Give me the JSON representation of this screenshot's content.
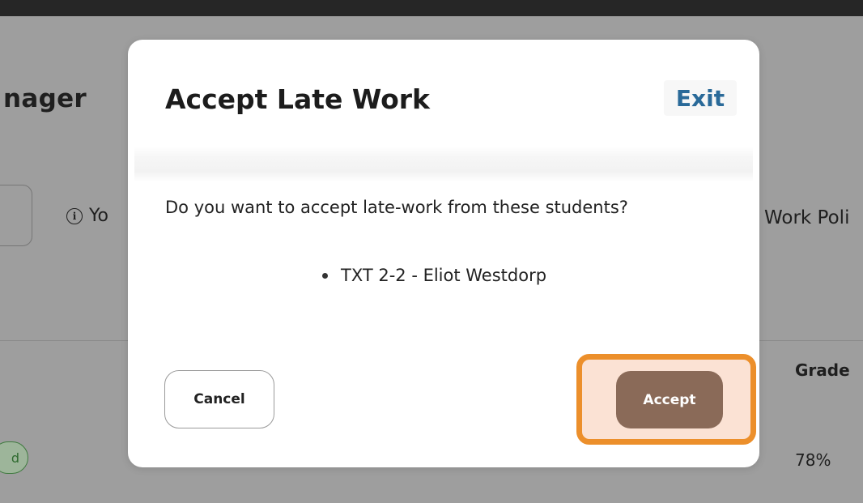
{
  "background": {
    "page_title_fragment": "nager",
    "info_text_fragment": "Yo",
    "info_icon": "info-circle-icon",
    "policy_fragment": "Work Poli",
    "table": {
      "grade_header": "Grade",
      "grade_value": "78%",
      "status_badge_fragment": "d"
    }
  },
  "modal": {
    "title": "Accept Late Work",
    "exit_label": "Exit",
    "prompt": "Do you want to accept late-work from these students?",
    "students": [
      "TXT 2-2 - Eliot Westdorp"
    ],
    "cancel_label": "Cancel",
    "accept_label": "Accept"
  },
  "colors": {
    "accent_link": "#2a6a99",
    "accept_button": "#8a6a58",
    "highlight_border": "#ec8f2b",
    "overlay": "#9e9e9e"
  }
}
